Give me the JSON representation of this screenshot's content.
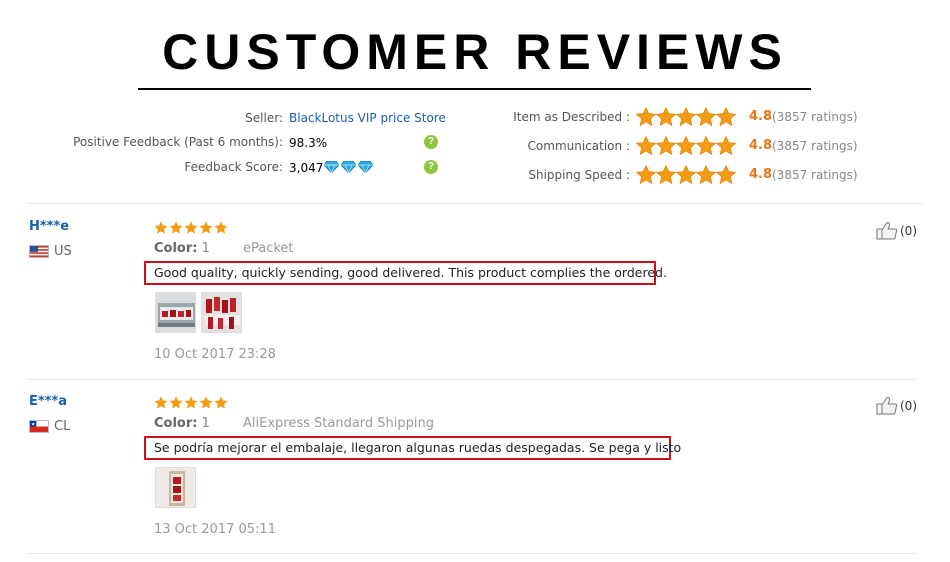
{
  "header": {
    "title": "CUSTOMER REVIEWS"
  },
  "seller_info": {
    "seller_label": "Seller:",
    "seller_name": "BlackLotus VIP price Store",
    "positive_label": "Positive Feedback (Past 6 months):",
    "positive_value": "98.3%",
    "score_label": "Feedback Score:",
    "score_value": "3,047",
    "help_glyph": "?"
  },
  "ratings": [
    {
      "label": "Item as Described :",
      "score": "4.8",
      "count": "(3857 ratings)",
      "stars": 5
    },
    {
      "label": "Communication :",
      "score": "4.8",
      "count": "(3857 ratings)",
      "stars": 5
    },
    {
      "label": "Shipping Speed :",
      "score": "4.8",
      "count": "(3857 ratings)",
      "stars": 5
    }
  ],
  "reviews": [
    {
      "user": "H***e",
      "country": "US",
      "flag": "us-flag",
      "stars": 5,
      "color_label": "Color:",
      "color_value": "1",
      "shipping": "ePacket",
      "feedback": "Good quality, quickly sending, good delivered. This product complies the ordered.",
      "date": "10 Oct 2017 23:28",
      "likes": "(0)"
    },
    {
      "user": "E***a",
      "country": "CL",
      "flag": "chile-flag",
      "stars": 5,
      "color_label": "Color:",
      "color_value": "1",
      "shipping": "AliExpress Standard Shipping",
      "feedback": "Se podría mejorar el embalaje, llegaron algunas ruedas despegadas. Se pega y listo",
      "date": "13 Oct 2017 05:11",
      "likes": "(0)"
    }
  ],
  "colors": {
    "link": "#1a5fb4",
    "star": "#f39c12",
    "score": "#e8751a",
    "highlight_border": "#c8101e",
    "help_green": "#8dc63f"
  },
  "icons": [
    "help-icon",
    "diamond-icon",
    "star-icon",
    "thumbs-up-icon",
    "us-flag",
    "chile-flag",
    "review-photo-thumbnail"
  ]
}
